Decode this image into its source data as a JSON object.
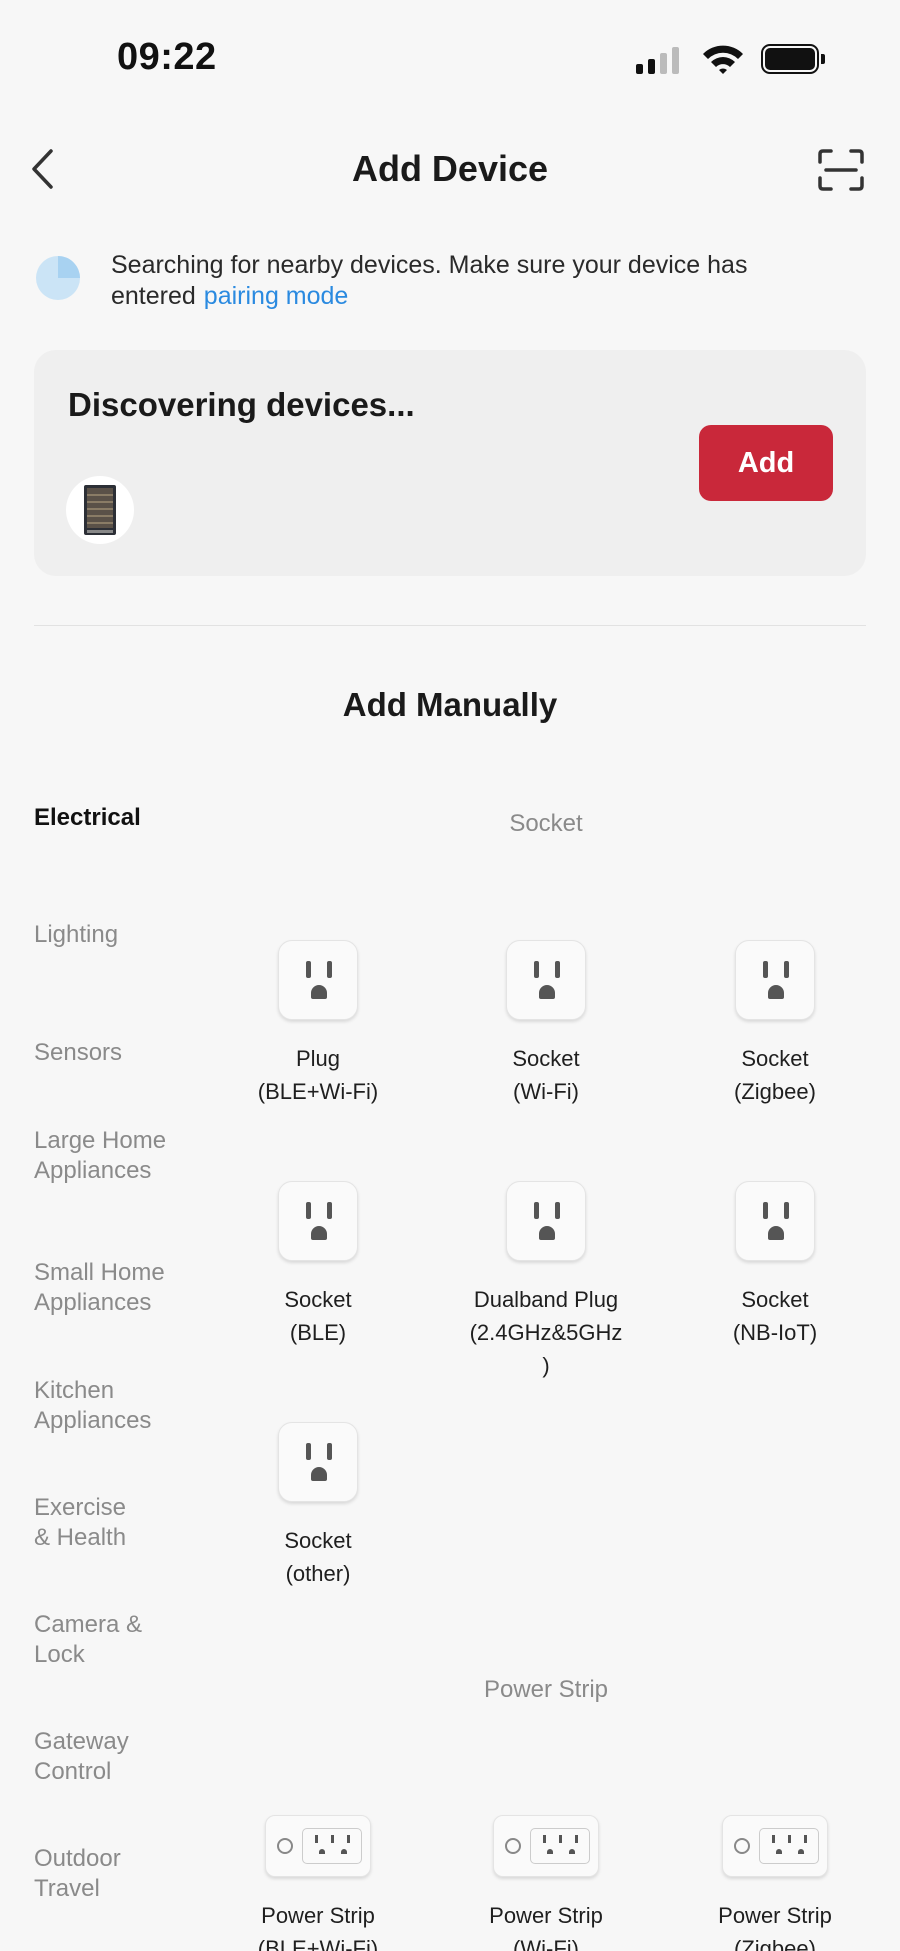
{
  "status_bar": {
    "time": "09:22",
    "signal_bars": 4,
    "signal_active_bars": 2
  },
  "header": {
    "title": "Add Device"
  },
  "search_hint": {
    "text": "Searching for nearby devices. Make sure your device has entered",
    "link": "pairing mode"
  },
  "discover": {
    "title": "Discovering devices...",
    "add_label": "Add"
  },
  "manual": {
    "title": "Add Manually"
  },
  "categories": [
    {
      "label": "Electrical",
      "active": true
    },
    {
      "label": "Lighting"
    },
    {
      "label": "Sensors"
    },
    {
      "label": "Large Home Appliances"
    },
    {
      "label": "Small Home Appliances"
    },
    {
      "label": "Kitchen Appliances"
    },
    {
      "label": "Exercise & Health"
    },
    {
      "label": "Camera & Lock"
    },
    {
      "label": "Gateway Control"
    },
    {
      "label": "Outdoor Travel"
    }
  ],
  "sections": [
    {
      "title": "Socket",
      "items": [
        {
          "label": "Plug\n(BLE+Wi-Fi)",
          "icon": "socket-icon"
        },
        {
          "label": "Socket\n(Wi-Fi)",
          "icon": "socket-icon"
        },
        {
          "label": "Socket\n(Zigbee)",
          "icon": "socket-icon"
        },
        {
          "label": "Socket\n(BLE)",
          "icon": "socket-icon"
        },
        {
          "label": "Dualband Plug\n(2.4GHz&5GHz\n)",
          "icon": "socket-icon"
        },
        {
          "label": "Socket\n(NB-IoT)",
          "icon": "socket-icon"
        },
        {
          "label": "Socket\n(other)",
          "icon": "socket-icon"
        }
      ]
    },
    {
      "title": "Power Strip",
      "items": [
        {
          "label": "Power Strip\n(BLE+Wi-Fi)",
          "icon": "power-strip-icon"
        },
        {
          "label": "Power Strip\n(Wi-Fi)",
          "icon": "power-strip-icon"
        },
        {
          "label": "Power Strip\n(Zigbee)",
          "icon": "power-strip-icon"
        }
      ]
    }
  ],
  "colors": {
    "accent": "#c9283a",
    "link": "#2a8ae0",
    "background": "#f7f7f7"
  }
}
